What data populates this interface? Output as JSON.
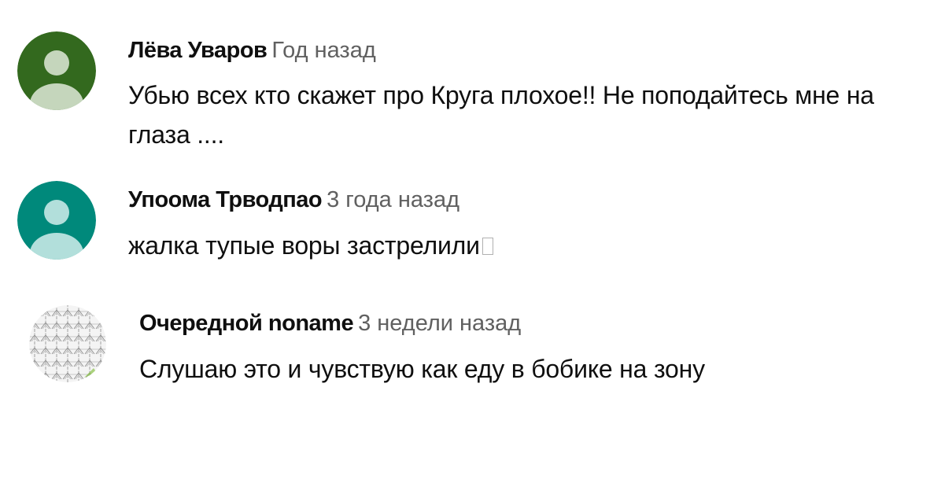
{
  "comments": [
    {
      "author": "Лёва Уваров",
      "time": "Год назад",
      "text": "Убью всех кто скажет про Круга плохое!! Не поподайтесь мне на глаза ....",
      "avatar": {
        "type": "default",
        "bg": "#33691e",
        "fg": "#c5d6bc"
      }
    },
    {
      "author": "Упоома Трводпао",
      "time": "3 года назад",
      "text": "жалка тупые воры застрелили",
      "trailing_glyph": "missing-character",
      "avatar": {
        "type": "default",
        "bg": "#00897b",
        "fg": "#b2dfdb"
      }
    },
    {
      "author": "Очередной noname",
      "time": "3 недели назад",
      "text": "Слушаю это и чувствую как еду в бобике на зону",
      "avatar": {
        "type": "pattern",
        "bg": "#f0f0f0",
        "fg": "#9e9e9e",
        "accent": "#8bc34a"
      }
    }
  ]
}
